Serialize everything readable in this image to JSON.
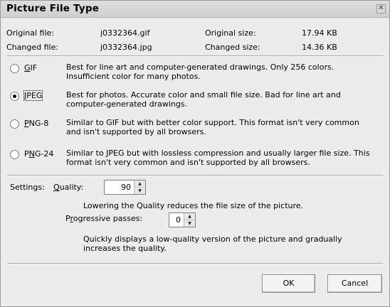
{
  "window": {
    "title": "Picture File Type",
    "close_icon": "close-icon"
  },
  "file_info": {
    "original_file_label": "Original file:",
    "original_file_value": "j0332364.gif",
    "original_size_label": "Original size:",
    "original_size_value": "17.94 KB",
    "changed_file_label": "Changed file:",
    "changed_file_value": "j0332364.jpg",
    "changed_size_label": "Changed size:",
    "changed_size_value": "14.36 KB"
  },
  "formats": [
    {
      "label_pre": "",
      "label_mnemonic": "G",
      "label_post": "IF",
      "checked": false,
      "desc1": "Best for line art and computer-generated drawings.  Only 256 colors.",
      "desc2": "Insufficient color for many photos."
    },
    {
      "label_pre": "",
      "label_mnemonic": "J",
      "label_post": "PEG",
      "checked": true,
      "desc1": "Best for photos.  Accurate color and small file size.  Bad for line art and",
      "desc2": "computer-generated drawings."
    },
    {
      "label_pre": "",
      "label_mnemonic": "P",
      "label_post": "NG-8",
      "checked": false,
      "desc1": "Similar to GIF but with better color support.   This format isn't very common",
      "desc2": "and isn't supported by all browsers."
    },
    {
      "label_pre": "P",
      "label_mnemonic": "N",
      "label_post": "G-24",
      "checked": false,
      "desc1": "Similar to JPEG but with lossless compression and usually larger file size.  This",
      "desc2": "format isn't very common and isn't supported by all browsers."
    }
  ],
  "settings": {
    "label": "Settings:",
    "quality_mnemonic": "Q",
    "quality_rest": "uality:",
    "quality_value": "90",
    "quality_hint": "Lowering the Quality reduces the file size of the picture.",
    "passes_pre": "P",
    "passes_mnemonic": "r",
    "passes_rest": "ogressive passes:",
    "passes_value": "0",
    "passes_hint1": "Quickly displays a low-quality version of the picture and gradually",
    "passes_hint2": "increases the quality."
  },
  "buttons": {
    "ok": "OK",
    "cancel": "Cancel"
  },
  "icons": {
    "spin_up": "▲",
    "spin_down": "▼",
    "close": "✕"
  }
}
